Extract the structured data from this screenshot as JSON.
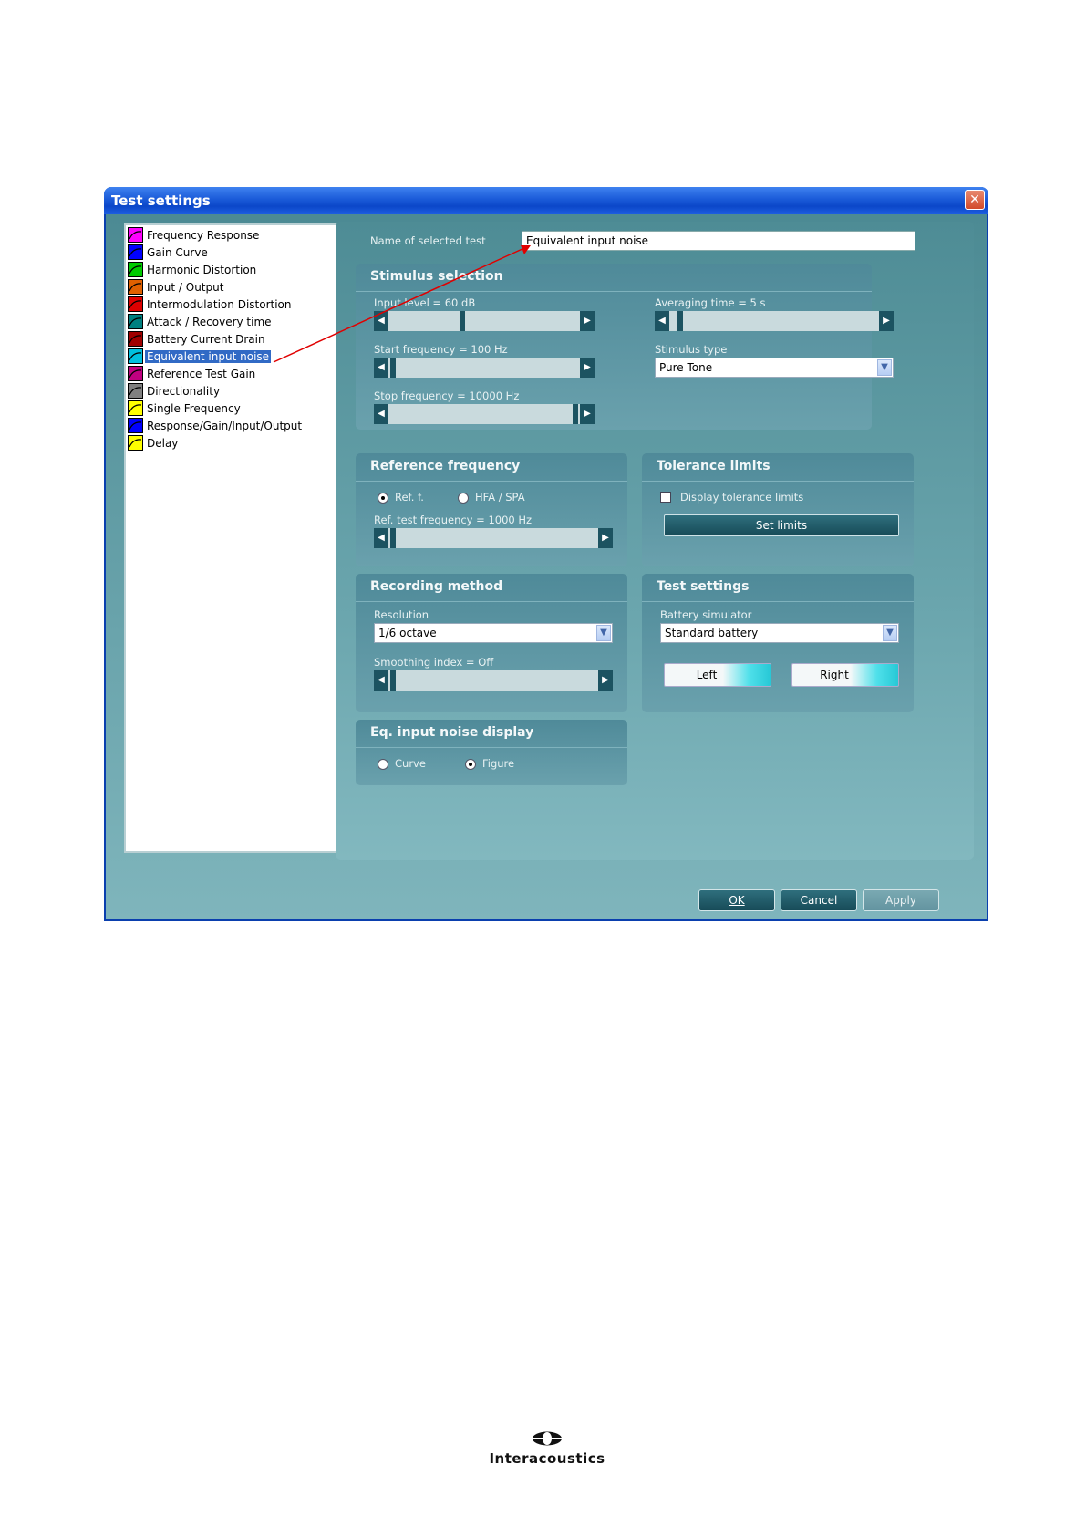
{
  "window": {
    "title": "Test settings"
  },
  "tests": [
    {
      "label": "Frequency Response",
      "color": "#ff00ff",
      "selected": false
    },
    {
      "label": "Gain Curve",
      "color": "#0000ff",
      "selected": false
    },
    {
      "label": "Harmonic Distortion",
      "color": "#00cc00",
      "selected": false
    },
    {
      "label": "Input / Output",
      "color": "#e06000",
      "selected": false
    },
    {
      "label": "Intermodulation Distortion",
      "color": "#dd0000",
      "selected": false
    },
    {
      "label": "Attack / Recovery time",
      "color": "#008080",
      "selected": false
    },
    {
      "label": "Battery Current Drain",
      "color": "#a00000",
      "selected": false
    },
    {
      "label": "Equivalent input noise",
      "color": "#00c0e0",
      "selected": true
    },
    {
      "label": "Reference Test Gain",
      "color": "#c00080",
      "selected": false
    },
    {
      "label": "Directionality",
      "color": "#808080",
      "selected": false
    },
    {
      "label": "Single Frequency",
      "color": "#ffff00",
      "selected": false
    },
    {
      "label": "Response/Gain/Input/Output",
      "color": "#0000ff",
      "selected": false
    },
    {
      "label": "Delay",
      "color": "#ffff00",
      "selected": false
    }
  ],
  "name_field": {
    "label": "Name of selected test",
    "value": "Equivalent input noise"
  },
  "stimulus": {
    "title": "Stimulus selection",
    "input_level": {
      "label": "Input level = 60 dB",
      "fraction": 0.38
    },
    "start_frequency": {
      "label": "Start frequency = 100 Hz",
      "fraction": 0.0
    },
    "stop_frequency": {
      "label": "Stop frequency = 10000 Hz",
      "fraction": 1.0
    },
    "averaging_time": {
      "label": "Averaging time = 5 s",
      "fraction": 0.03
    },
    "stimulus_type": {
      "label": "Stimulus type",
      "value": "Pure Tone"
    }
  },
  "reference": {
    "title": "Reference frequency",
    "ref_f_label": "Ref. f.",
    "hfa_label": "HFA / SPA",
    "selected": "ref_f",
    "ref_test_frequency": {
      "label": "Ref. test frequency = 1000 Hz",
      "fraction": 0.0
    }
  },
  "tolerance": {
    "title": "Tolerance limits",
    "display_label": "Display tolerance limits",
    "checked": false,
    "set_limits_label": "Set limits"
  },
  "recording": {
    "title": "Recording method",
    "resolution_label": "Resolution",
    "resolution_value": "1/6 octave",
    "smoothing": {
      "label": "Smoothing index = Off",
      "fraction": 0.0
    }
  },
  "test_settings": {
    "title": "Test settings",
    "battery_label": "Battery simulator",
    "battery_value": "Standard battery",
    "left_label": "Left",
    "right_label": "Right"
  },
  "eq_display": {
    "title": "Eq. input noise display",
    "curve_label": "Curve",
    "figure_label": "Figure",
    "selected": "figure"
  },
  "buttons": {
    "ok": "OK",
    "cancel": "Cancel",
    "apply": "Apply"
  },
  "logo": {
    "text": "Interacoustics"
  }
}
